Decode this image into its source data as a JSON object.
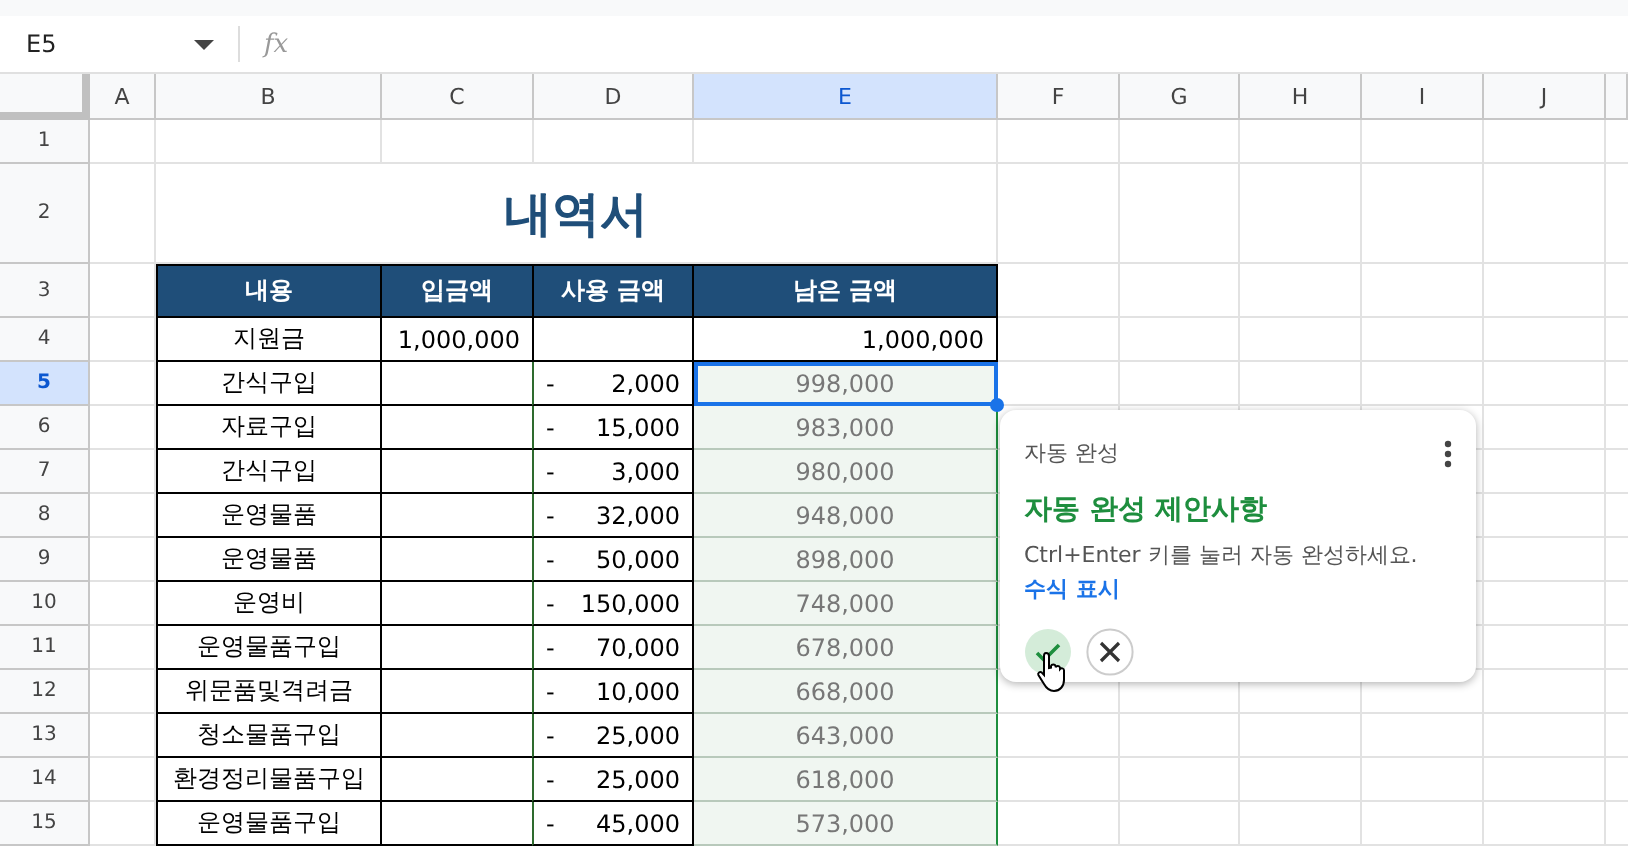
{
  "name_box": "E5",
  "formula_icon": "fx",
  "columns": [
    {
      "label": "A",
      "selected": false
    },
    {
      "label": "B",
      "selected": false
    },
    {
      "label": "C",
      "selected": false
    },
    {
      "label": "D",
      "selected": false
    },
    {
      "label": "E",
      "selected": true
    },
    {
      "label": "F",
      "selected": false
    },
    {
      "label": "G",
      "selected": false
    },
    {
      "label": "H",
      "selected": false
    },
    {
      "label": "I",
      "selected": false
    },
    {
      "label": "J",
      "selected": false
    }
  ],
  "rows": [
    {
      "label": "1",
      "selected": false
    },
    {
      "label": "2",
      "selected": false
    },
    {
      "label": "3",
      "selected": false
    },
    {
      "label": "4",
      "selected": false
    },
    {
      "label": "5",
      "selected": true
    },
    {
      "label": "6",
      "selected": false
    },
    {
      "label": "7",
      "selected": false
    },
    {
      "label": "8",
      "selected": false
    },
    {
      "label": "9",
      "selected": false
    },
    {
      "label": "10",
      "selected": false
    },
    {
      "label": "11",
      "selected": false
    },
    {
      "label": "12",
      "selected": false
    },
    {
      "label": "13",
      "selected": false
    },
    {
      "label": "14",
      "selected": false
    },
    {
      "label": "15",
      "selected": false
    }
  ],
  "title": "내역서",
  "table": {
    "headers": [
      "내용",
      "입금액",
      "사용 금액",
      "남은 금액"
    ],
    "rows": [
      {
        "item": "지원금",
        "deposit": "1,000,000",
        "usage_sign": "",
        "usage": "",
        "remaining": "1,000,000",
        "suggested": false,
        "selected": false
      },
      {
        "item": "간식구입",
        "usage_sign": "-",
        "usage": "2,000",
        "remaining": "998,000",
        "suggested": true,
        "selected": true
      },
      {
        "item": "자료구입",
        "usage_sign": "-",
        "usage": "15,000",
        "remaining": "983,000",
        "suggested": true,
        "selected": false
      },
      {
        "item": "간식구입",
        "usage_sign": "-",
        "usage": "3,000",
        "remaining": "980,000",
        "suggested": true,
        "selected": false
      },
      {
        "item": "운영물품",
        "usage_sign": "-",
        "usage": "32,000",
        "remaining": "948,000",
        "suggested": true,
        "selected": false
      },
      {
        "item": "운영물품",
        "usage_sign": "-",
        "usage": "50,000",
        "remaining": "898,000",
        "suggested": true,
        "selected": false
      },
      {
        "item": "운영비",
        "usage_sign": "-",
        "usage": "150,000",
        "remaining": "748,000",
        "suggested": true,
        "selected": false
      },
      {
        "item": "운영물품구입",
        "usage_sign": "-",
        "usage": "70,000",
        "remaining": "678,000",
        "suggested": true,
        "selected": false
      },
      {
        "item": "위문품및격려금",
        "usage_sign": "-",
        "usage": "10,000",
        "remaining": "668,000",
        "suggested": true,
        "selected": false
      },
      {
        "item": "청소물품구입",
        "usage_sign": "-",
        "usage": "25,000",
        "remaining": "643,000",
        "suggested": true,
        "selected": false
      },
      {
        "item": "환경정리물품구입",
        "usage_sign": "-",
        "usage": "25,000",
        "remaining": "618,000",
        "suggested": true,
        "selected": false
      },
      {
        "item": "운영물품구입",
        "usage_sign": "-",
        "usage": "45,000",
        "remaining": "573,000",
        "suggested": true,
        "selected": false
      }
    ]
  },
  "autocomplete": {
    "label": "자동 완성",
    "heading": "자동 완성 제안사항",
    "description": "Ctrl+Enter 키를 눌러 자동 완성하세요.",
    "link": "수식 표시"
  }
}
